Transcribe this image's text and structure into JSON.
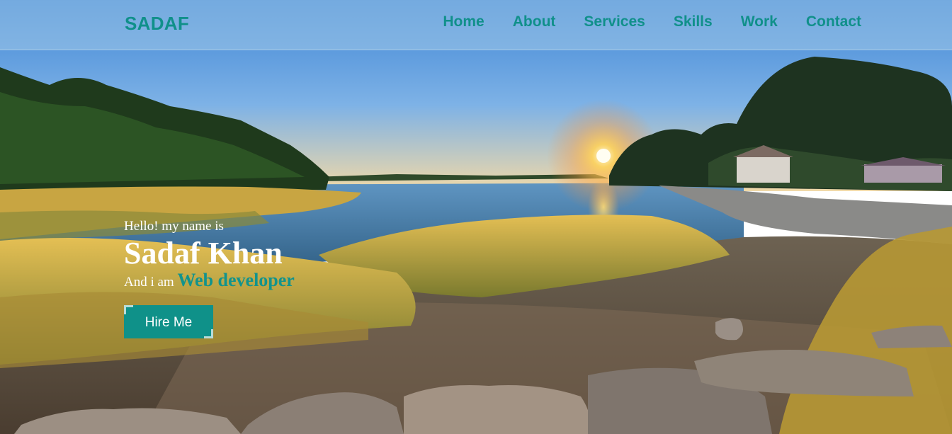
{
  "nav": {
    "brand": "SADAF",
    "links": [
      "Home",
      "About",
      "Services",
      "Skills",
      "Work",
      "Contact"
    ]
  },
  "hero": {
    "greeting": "Hello! my name is",
    "name": "Sadaf Khan",
    "role_prefix": "And i am",
    "role": "Web developer",
    "cta_label": "Hire Me"
  },
  "colors": {
    "accent": "#10908a",
    "text_light": "#ffffff"
  },
  "icons": []
}
